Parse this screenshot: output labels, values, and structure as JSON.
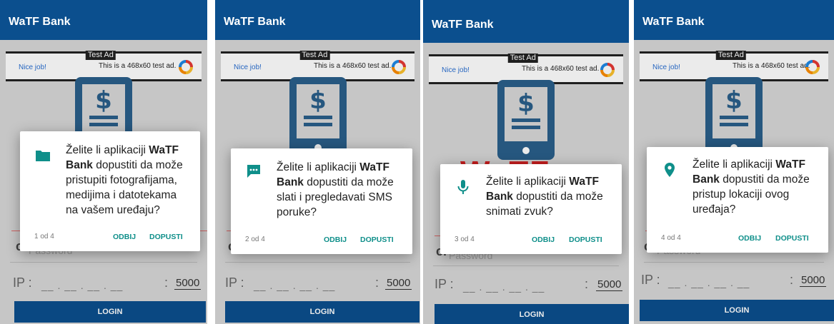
{
  "app_title": "WaTF Bank",
  "ad": {
    "badge": "Test Ad",
    "nice": "Nice job!",
    "text": "This is a 468x60 test ad."
  },
  "form": {
    "password_placeholder": "Password",
    "ip_label": "IP :",
    "ip_fields": "__ . __ . __ . __",
    "port_separator": ":",
    "port_value": "5000",
    "login_label": "LOGIN"
  },
  "brand_fragment": "WaTF",
  "dialogs": [
    {
      "icon": "folder-icon",
      "text_prefix": "Želite li aplikaciji ",
      "app_name": "WaTF Bank",
      "text_suffix": " dopustiti da može pristupiti fotografijama, medijima i datotekama na vašem uređaju?",
      "counter": "1 od 4",
      "deny": "ODBIJ",
      "allow": "DOPUSTI"
    },
    {
      "icon": "sms-icon",
      "text_prefix": "Želite li aplikaciji ",
      "app_name": "WaTF Bank",
      "text_suffix": " dopustiti da može slati i pregledavati SMS poruke?",
      "counter": "2 od 4",
      "deny": "ODBIJ",
      "allow": "DOPUSTI"
    },
    {
      "icon": "microphone-icon",
      "text_prefix": "Želite li aplikaciji ",
      "app_name": "WaTF Bank",
      "text_suffix": " dopustiti da može snimati zvuk?",
      "counter": "3 od 4",
      "deny": "ODBIJ",
      "allow": "DOPUSTI"
    },
    {
      "icon": "location-icon",
      "text_prefix": "Želite li aplikaciji ",
      "app_name": "WaTF Bank",
      "text_suffix": " dopustiti da može pristup lokaciji ovog uređaja?",
      "counter": "4 od 4",
      "deny": "ODBIJ",
      "allow": "DOPUSTI"
    }
  ],
  "colors": {
    "app_bar": "#0b4f8e",
    "dialog_accent": "#0f8f8a",
    "dim_background": "#d7d7d7",
    "brand_red": "#d42020"
  }
}
